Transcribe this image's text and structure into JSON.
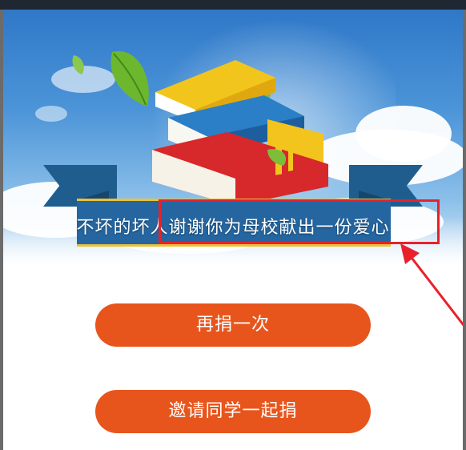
{
  "banner": {
    "message": "不坏的坏人谢谢你为母校献出一份爱心"
  },
  "actions": {
    "donate_again": "再捐一次",
    "invite_classmates": "邀请同学一起捐"
  },
  "colors": {
    "button": "#e8551c",
    "highlight": "#e8212b",
    "ribbon": "#2566a0",
    "sky": "#3b86d0"
  }
}
